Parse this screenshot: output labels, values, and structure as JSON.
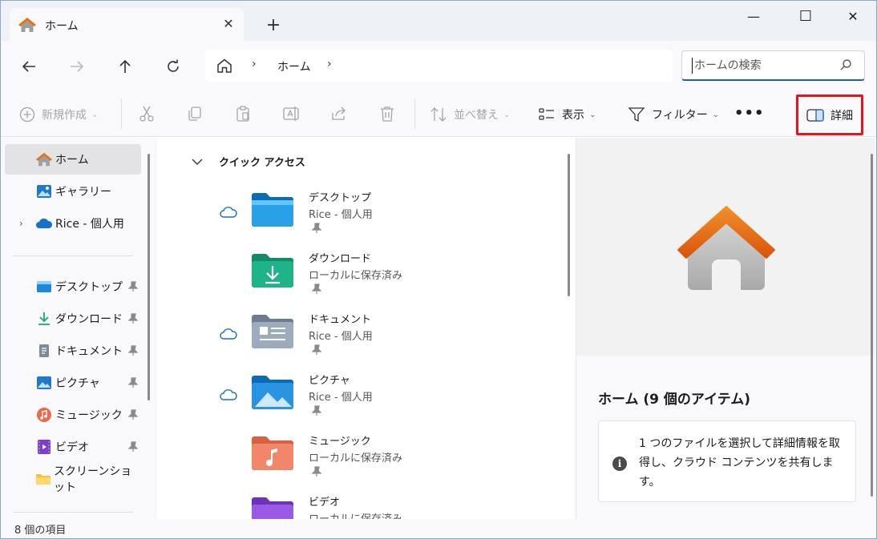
{
  "tab": {
    "title": "ホーム",
    "close": "✕",
    "new_tab": "+"
  },
  "window": {
    "minimize": "—",
    "maximize": "☐",
    "close": "✕"
  },
  "address": {
    "crumbs": [
      "ホーム"
    ],
    "separator": "›"
  },
  "search": {
    "placeholder": "ホームの検索",
    "value": ""
  },
  "commands": {
    "new": "新規作成",
    "sort": "並べ替え",
    "view": "表示",
    "filter": "フィルター",
    "more": "•••",
    "details": "詳細"
  },
  "sidebar": {
    "items": [
      {
        "label": "ホーム",
        "icon": "home-icon",
        "selected": true
      },
      {
        "label": "ギャラリー",
        "icon": "gallery-icon"
      },
      {
        "label": "Rice - 個人用",
        "icon": "onedrive-cloud-icon"
      }
    ],
    "pinned": [
      {
        "label": "デスクトップ",
        "icon": "desktop-folder-icon"
      },
      {
        "label": "ダウンロード",
        "icon": "download-icon"
      },
      {
        "label": "ドキュメント",
        "icon": "document-icon"
      },
      {
        "label": "ピクチャ",
        "icon": "pictures-icon"
      },
      {
        "label": "ミュージック",
        "icon": "music-icon"
      },
      {
        "label": "ビデオ",
        "icon": "video-icon"
      },
      {
        "label": "スクリーンショット",
        "icon": "folder-icon"
      }
    ]
  },
  "quick_access": {
    "header": "クイック アクセス",
    "items": [
      {
        "name": "デスクトップ",
        "location": "Rice - 個人用",
        "cloud": true
      },
      {
        "name": "ダウンロード",
        "location": "ローカルに保存済み",
        "cloud": false
      },
      {
        "name": "ドキュメント",
        "location": "Rice - 個人用",
        "cloud": true
      },
      {
        "name": "ピクチャ",
        "location": "Rice - 個人用",
        "cloud": true
      },
      {
        "name": "ミュージック",
        "location": "ローカルに保存済み",
        "cloud": false
      },
      {
        "name": "ビデオ",
        "location": "ローカルに保存済み",
        "cloud": false
      }
    ]
  },
  "details_pane": {
    "title": "ホーム (9 個のアイテム)",
    "info": "1 つのファイルを選択して詳細情報を取得し、クラウド コンテンツを共有します。"
  },
  "status": {
    "count": "8 個の項目"
  },
  "colors": {
    "accent": "#1d5fb0",
    "highlight": "#e8131f",
    "home_roof": "#e8720f"
  }
}
